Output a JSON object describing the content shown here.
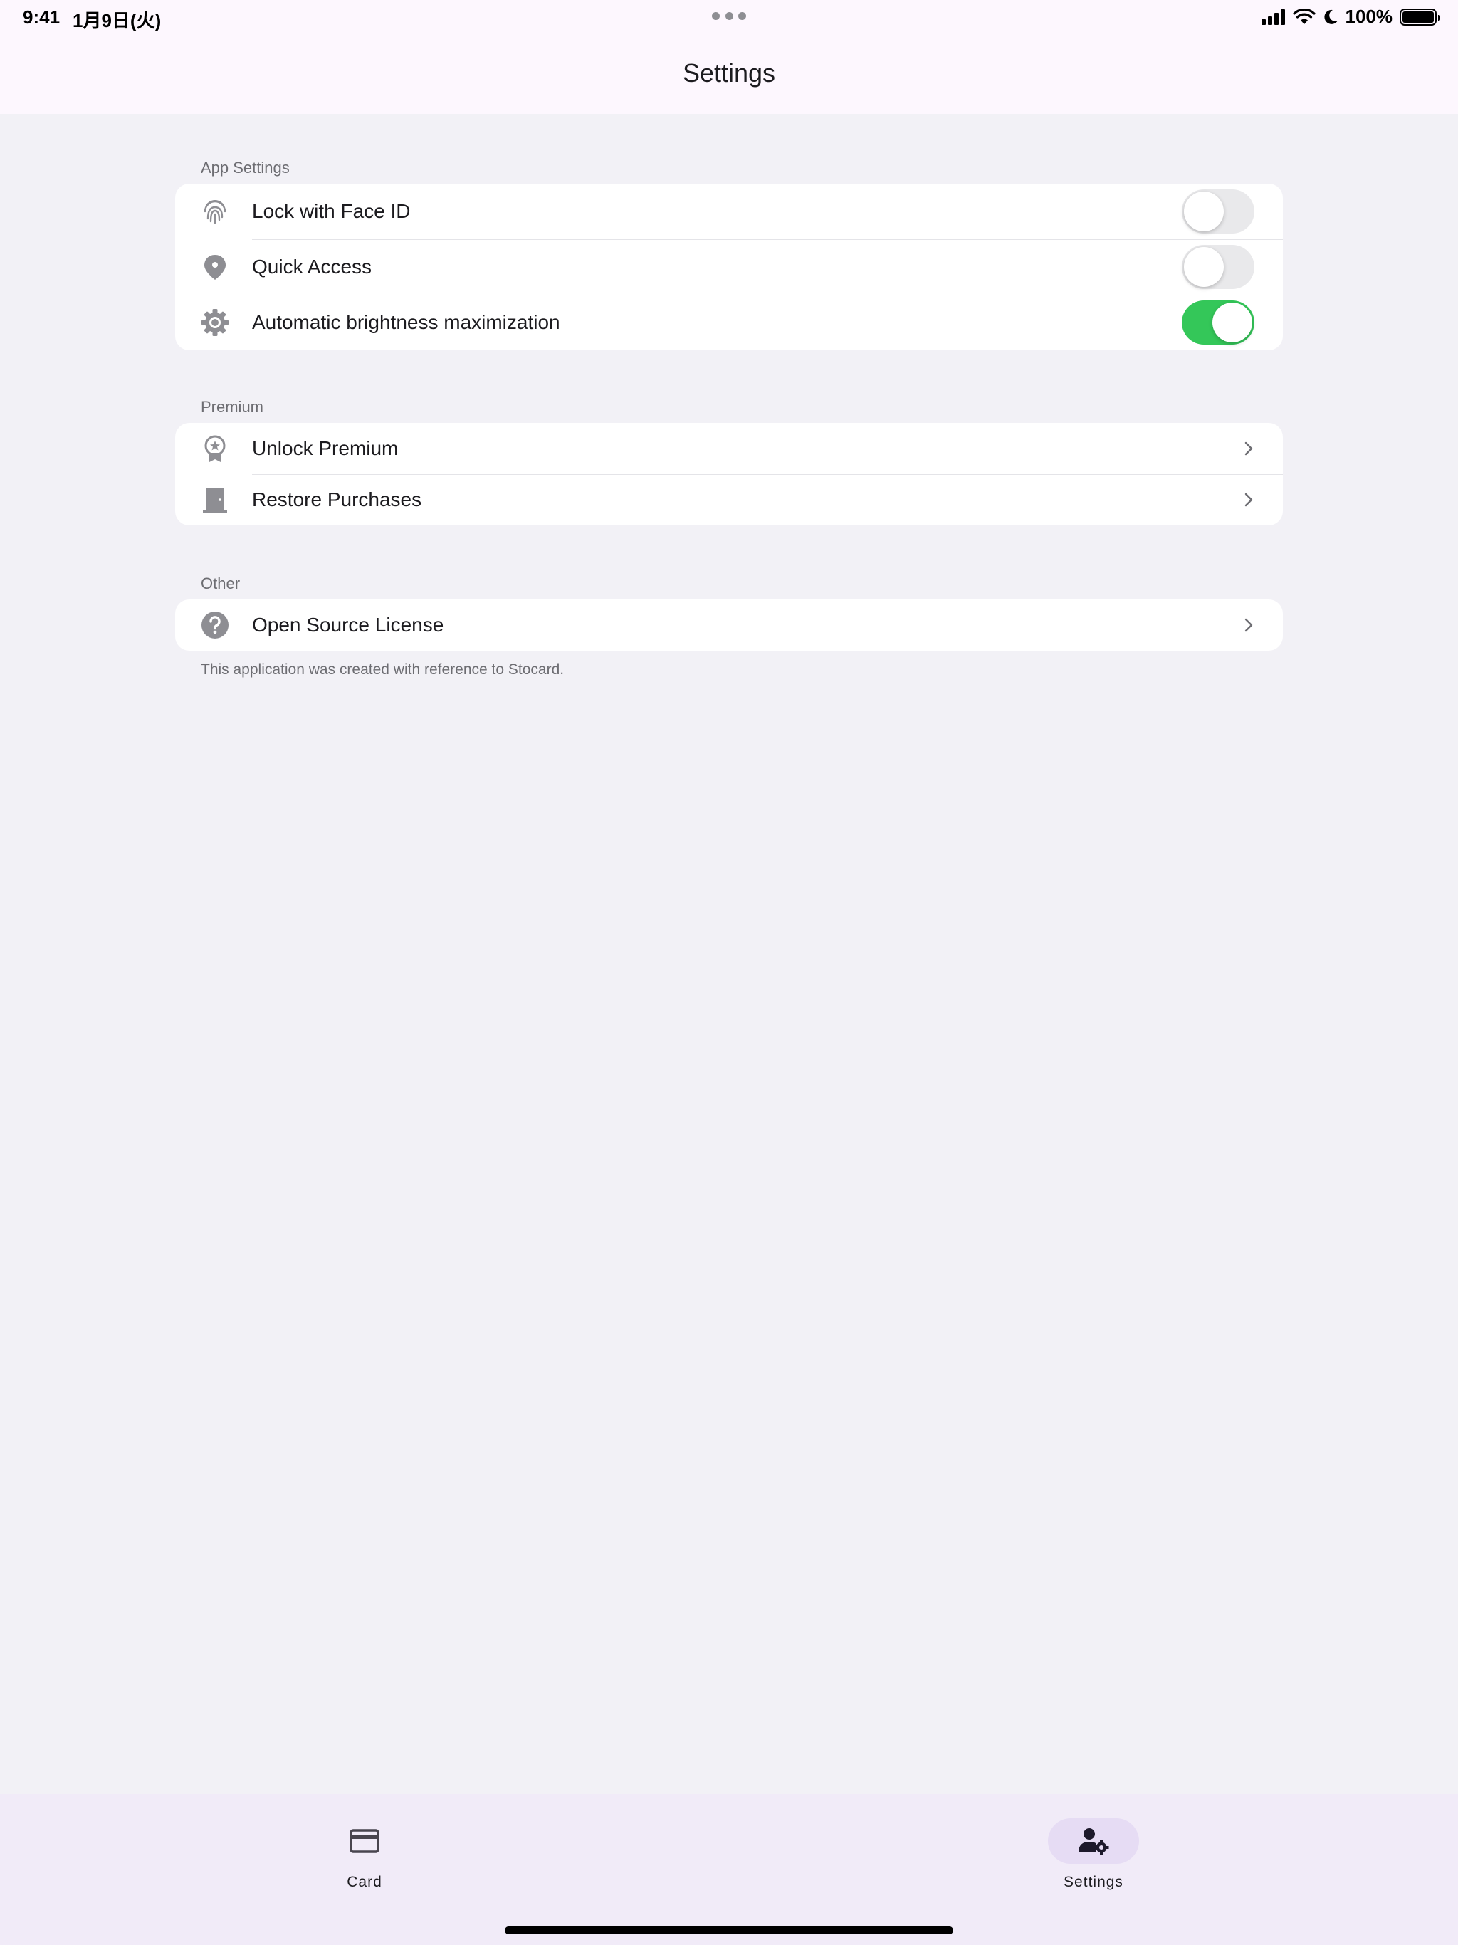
{
  "status_bar": {
    "time": "9:41",
    "date": "1月9日(火)",
    "battery": "100%"
  },
  "header": {
    "title": "Settings"
  },
  "sections": {
    "app_settings": {
      "label": "App Settings",
      "items": [
        {
          "label": "Lock with Face ID",
          "icon": "fingerprint-icon",
          "toggle": false
        },
        {
          "label": "Quick Access",
          "icon": "location-pin-icon",
          "toggle": false
        },
        {
          "label": "Automatic brightness maximization",
          "icon": "gear-icon",
          "toggle": true
        }
      ]
    },
    "premium": {
      "label": "Premium",
      "items": [
        {
          "label": "Unlock Premium",
          "icon": "award-ribbon-icon"
        },
        {
          "label": "Restore Purchases",
          "icon": "door-icon"
        }
      ]
    },
    "other": {
      "label": "Other",
      "items": [
        {
          "label": "Open Source License",
          "icon": "question-circle-icon"
        }
      ],
      "footnote": "This application was created with reference to Stocard."
    }
  },
  "tabbar": {
    "tabs": [
      {
        "label": "Card",
        "icon": "credit-card-icon",
        "active": false
      },
      {
        "label": "Settings",
        "icon": "person-settings-icon",
        "active": true
      }
    ]
  },
  "colors": {
    "toggle_on": "#34c759",
    "toggle_off": "#e9e9eb",
    "icon_gray": "#8e8e93",
    "header_bg": "#fdf7fe",
    "tab_active_pill": "#e6dcf4"
  }
}
